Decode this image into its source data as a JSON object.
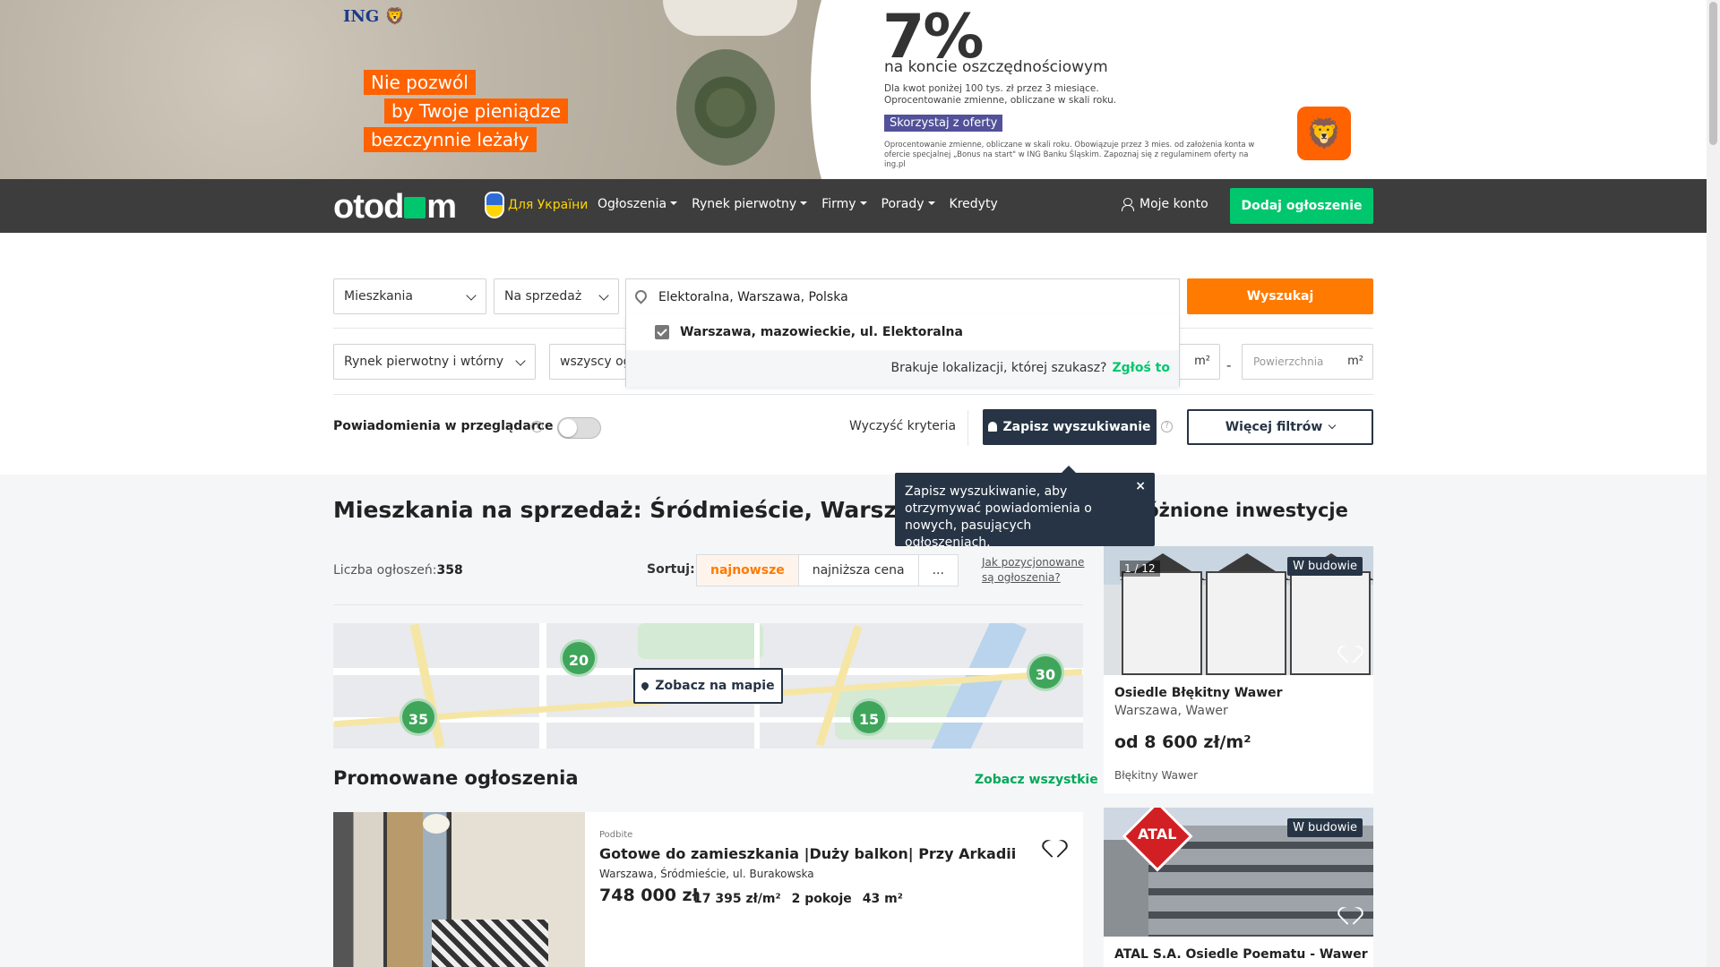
{
  "ad": {
    "brand": "ING",
    "tags": [
      "Nie pozwól",
      "by Twoje pieniądze",
      "bezczynnie leżały"
    ],
    "rate": "7%",
    "headline": "na koncie oszczędnościowym",
    "small": "Dla kwot poniżej 100 tys. zł przez 3 miesiące. Oprocentowanie zmienne, obliczane w skali roku.",
    "cta": "Skorzystaj z oferty",
    "fine": "Oprocentowanie zmienne, obliczane w skali roku. Obowiązuje przez 3 mies. od założenia konta w ofercie specjalnej „Bonus na start\" w ING Banku Śląskim. Zapoznaj się z regulaminem oferty na ing.pl"
  },
  "nav": {
    "logo": "otodom",
    "ukraine": "Для України",
    "menu": [
      "Ogłoszenia",
      "Rynek pierwotny",
      "Firmy",
      "Porady",
      "Kredyty"
    ],
    "account": "Moje konto",
    "add_listing": "Dodaj ogłoszenie"
  },
  "search": {
    "property_type": "Mieszkania",
    "transaction": "Na sprzedaż",
    "location": "Elektoralna, Warszawa, Polska",
    "search_button": "Wyszukaj",
    "market": "Rynek pierwotny i wtórny",
    "offer_type": "wszyscy ogłoszeniodawcy",
    "area_unit": "m²",
    "area_to_placeholder": "Powierzchnia",
    "dash": "-",
    "dropdown_item": "Warszawa, mazowieckie, ul. Elektoralna",
    "missing_location": "Brakuje lokalizacji, której szukasz?",
    "report": "Zgłoś to",
    "notifications_label": "Powiadomienia w przeglądarce",
    "clear": "Wyczyść kryteria",
    "save_search": "Zapisz wyszukiwanie",
    "more_filters": "Więcej filtrów",
    "help": "?"
  },
  "tooltip": {
    "text": "Zapisz wyszukiwanie, aby otrzymywać powiadomienia o nowych, pasujących ogłoszeniach.",
    "close": "×"
  },
  "results": {
    "title": "Mieszkania na sprzedaż: Śródmieście, Warszawa",
    "count_label": "Liczba ogłoszeń:",
    "count": "358",
    "sort_label": "Sortuj:",
    "sort_options": [
      "najnowsze",
      "najniższa cena",
      "..."
    ],
    "positioning_link": "Jak pozycjonowane są ogłoszenia?",
    "map_button": "Zobacz na mapie",
    "clusters": [
      "20",
      "30",
      "35",
      "15"
    ]
  },
  "promoted": {
    "title": "Promowane ogłoszenia",
    "see_all": "Zobacz wszystkie",
    "listing": {
      "tag": "Podbite",
      "title": "Gotowe do zamieszkania |Duży balkon| Przy Arkadii",
      "address": "Warszawa, Śródmieście, ul. Burakowska",
      "price": "748 000 zł",
      "price_per_m2": "17 395 zł/m²",
      "rooms": "2 pokoje",
      "area": "43 m²"
    }
  },
  "featured": {
    "title": "Wyróżnione inwestycje",
    "items": [
      {
        "badge": "W budowie",
        "counter": "1 / 12",
        "name": "Osiedle Błękitny Wawer",
        "location": "Warszawa, Wawer",
        "price": "od 8 600 zł/m²",
        "developer": "Błękitny Wawer"
      },
      {
        "badge": "W budowie",
        "sign": "ATAL",
        "name": "ATAL S.A. Osiedle Poematu - Wawer"
      }
    ]
  },
  "colors": {
    "brand_green": "#00c76d",
    "search_orange": "#ff7a00",
    "navy": "#263445",
    "nav_bg": "#3d3d3d"
  }
}
